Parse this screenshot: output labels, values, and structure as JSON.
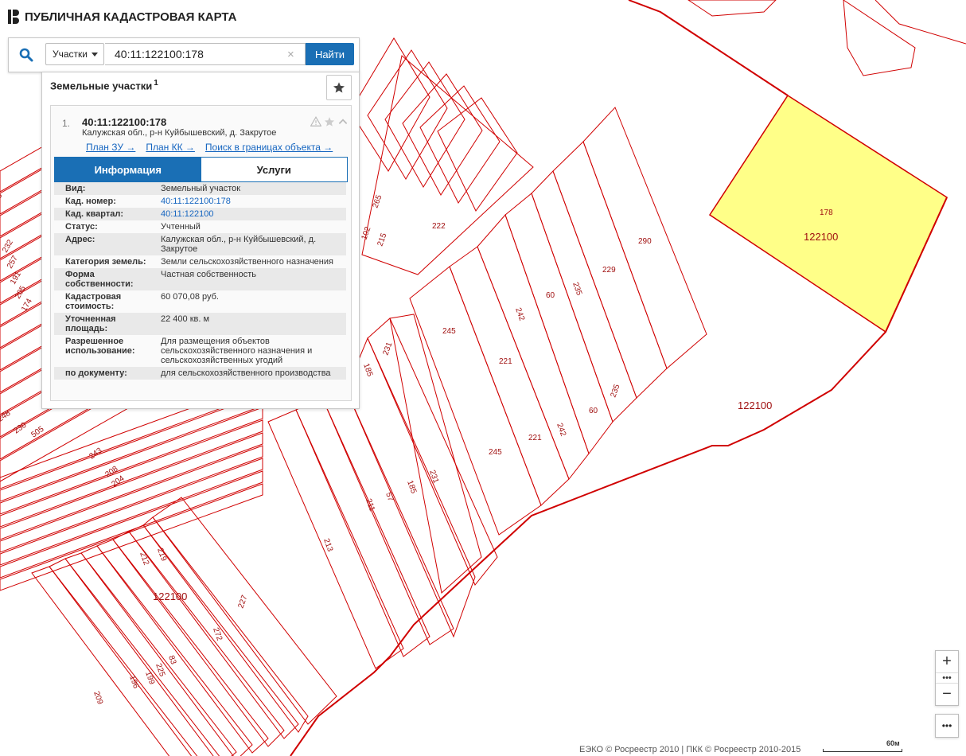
{
  "header": {
    "title": "ПУБЛИЧНАЯ КАДАСТРОВАЯ КАРТА"
  },
  "search": {
    "type_label": "Участки",
    "query": "40:11:122100:178",
    "clear_symbol": "×",
    "find_label": "Найти"
  },
  "results": {
    "heading": "Земельные участки",
    "count": "1",
    "item": {
      "index": "1.",
      "number": "40:11:122100:178",
      "address": "Калужская обл., р-н Куйбышевский, д. Закрутое",
      "links": [
        "План ЗУ →",
        "План КК →",
        "Поиск в границах объекта →"
      ],
      "tabs": [
        "Информация",
        "Услуги"
      ],
      "active_tab": "Информация",
      "info": [
        {
          "k": "Вид:",
          "v": "Земельный участок"
        },
        {
          "k": "Кад. номер:",
          "v": "40:11:122100:178",
          "link": true
        },
        {
          "k": "Кад. квартал:",
          "v": "40:11:122100",
          "link": true
        },
        {
          "k": "Статус:",
          "v": "Учтенный"
        },
        {
          "k": "Адрес:",
          "v": "Калужская обл., р-н Куйбышевский, д. Закрутое"
        },
        {
          "k": "Категория земель:",
          "v": "Земли сельскохозяйственного назначения"
        },
        {
          "k": "Форма собственности:",
          "v": "Частная собственность"
        },
        {
          "k": "Кадастровая стоимость:",
          "v": "60 070,08 руб."
        },
        {
          "k": "Уточненная площадь:",
          "v": "22 400 кв. м"
        },
        {
          "k": "Разрешенное использование:",
          "v": "Для размещения объектов сельскохозяйственного назначения и сельскохозяйственных угодий"
        },
        {
          "k": "по документу:",
          "v": "для сельскохозяйственного производства"
        }
      ]
    }
  },
  "map": {
    "parcel_color": "#d00000",
    "highlight_fill": "#ffff88",
    "labels": [
      "178",
      "122100",
      "122100",
      "122100",
      "290",
      "229",
      "235",
      "235",
      "60",
      "60",
      "242",
      "242",
      "221",
      "221",
      "245",
      "245",
      "222",
      "215",
      "102",
      "265",
      "231",
      "231",
      "185",
      "185",
      "57",
      "211",
      "213",
      "232",
      "257",
      "191",
      "205",
      "174",
      "5",
      "248",
      "230",
      "505",
      "243",
      "208",
      "204",
      "212",
      "219",
      "227",
      "272",
      "83",
      "225",
      "199",
      "196",
      "209"
    ]
  },
  "controls": {
    "zoom_in": "+",
    "zoom_dots": "•••",
    "zoom_out": "−",
    "more": "•••"
  },
  "footer": {
    "attribution": "ЕЭКО © Росреестр 2010 | ПКК © Росреестр 2010-2015",
    "scale_label": "60м"
  }
}
